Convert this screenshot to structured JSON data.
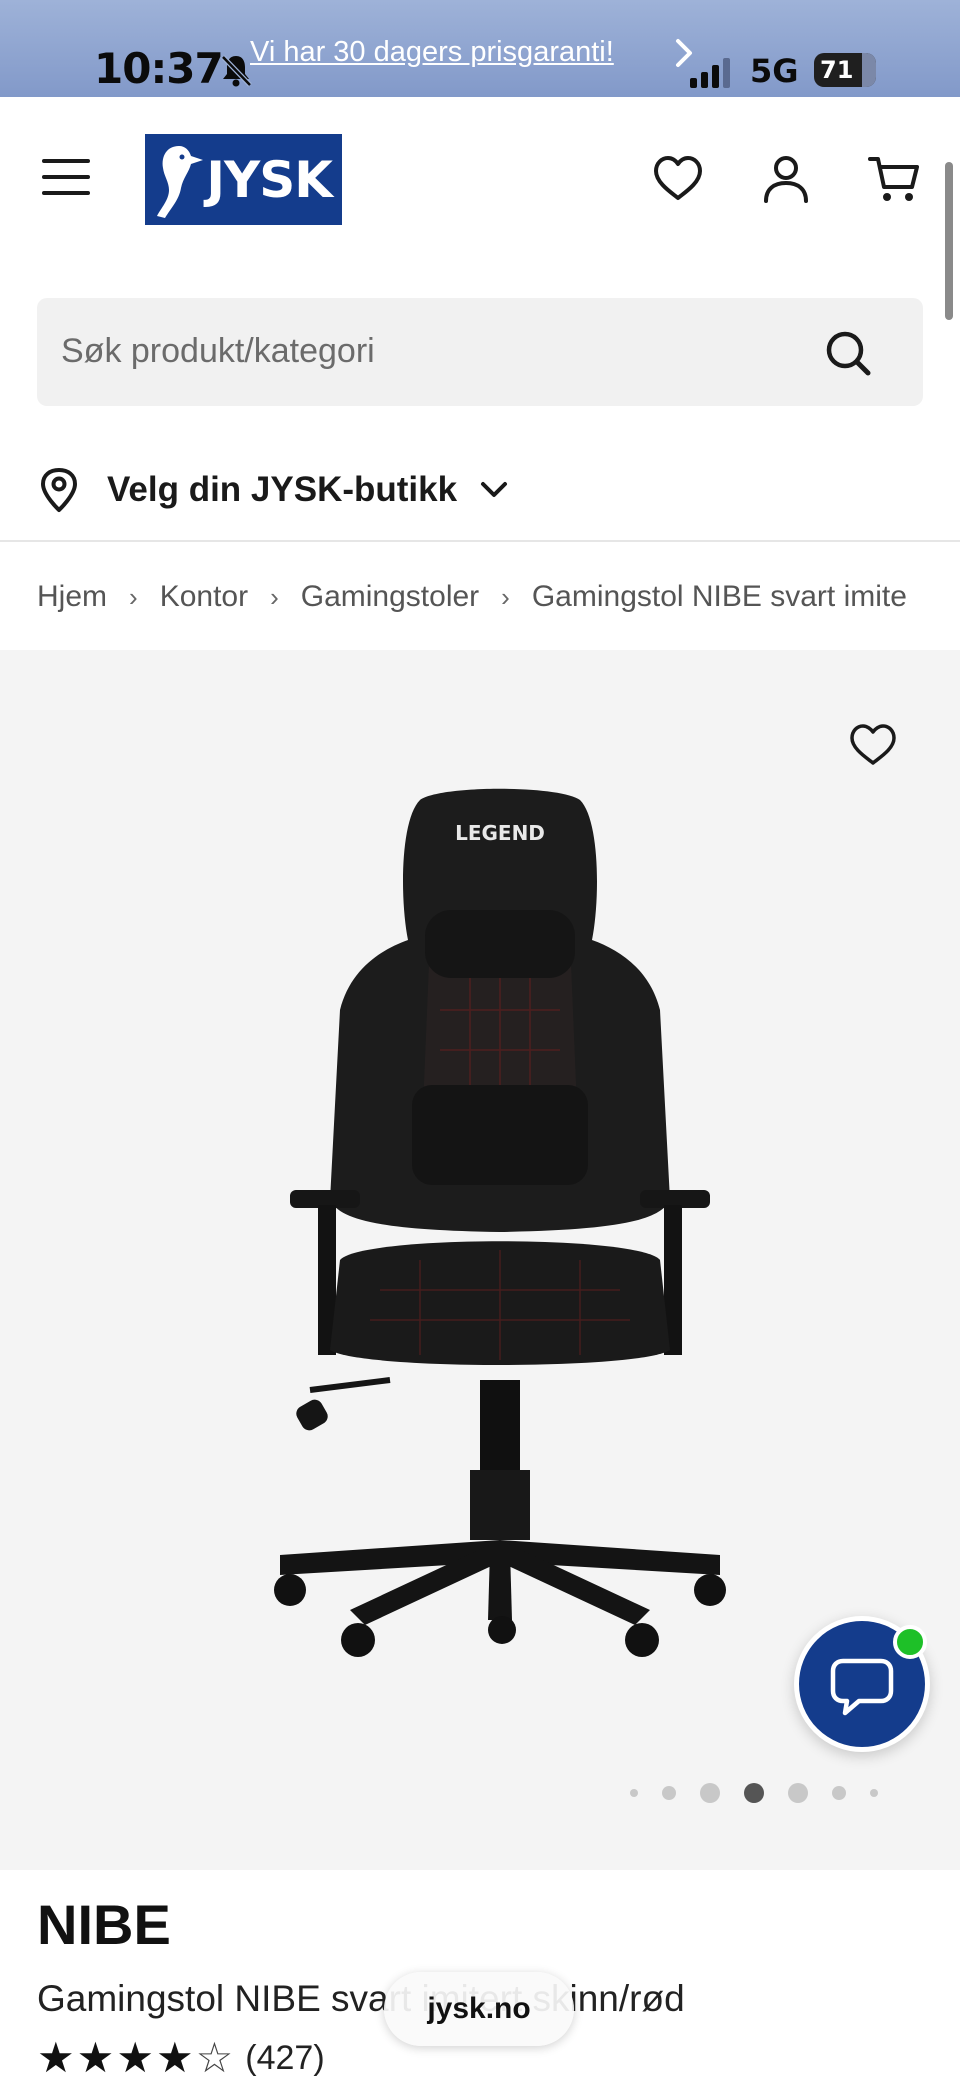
{
  "status_bar": {
    "time": "10:37",
    "promo": "Vi har 30 dagers prisgaranti!",
    "network": "5G",
    "battery": "71"
  },
  "header": {
    "logo_text": "JYSK",
    "brand_color": "#143c8c"
  },
  "search": {
    "placeholder": "Søk produkt/kategori"
  },
  "store": {
    "label": "Velg din JYSK-butikk"
  },
  "breadcrumb": [
    "Hjem",
    "Kontor",
    "Gamingstoler",
    "Gamingstol NIBE svart imite"
  ],
  "gallery": {
    "chair_logo_text": "LEGEND",
    "image_count": 7,
    "active_index": 3
  },
  "product": {
    "brand": "NIBE",
    "name": "Gamingstol NIBE svart imitert skinn/rød",
    "rating": 4,
    "rating_max": 5,
    "review_count": "(427)"
  },
  "browser": {
    "url": "jysk.no"
  },
  "colors": {
    "chat_button": "#143c8c",
    "online_indicator": "#1ec028"
  }
}
